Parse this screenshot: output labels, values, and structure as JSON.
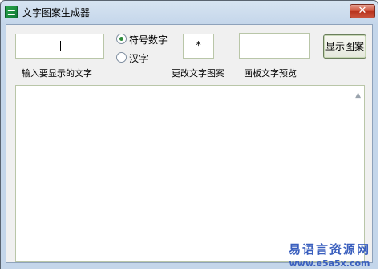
{
  "window": {
    "title": "文字图案生成器"
  },
  "inputs": {
    "text_input_value": "|",
    "symbol_value": "*",
    "preview_value": ""
  },
  "radios": [
    {
      "label": "符号数字",
      "checked": true
    },
    {
      "label": "汉字",
      "checked": false
    }
  ],
  "labels": {
    "input_text": "输入要显示的文字",
    "change_pattern": "更改文字图案",
    "canvas_preview": "画板文字预览"
  },
  "buttons": {
    "show_pattern": "显示图案"
  },
  "output": {
    "content": ""
  },
  "watermark": {
    "line1": "易语言资源网",
    "line2": "www.e5a5x.com"
  },
  "colors": {
    "accent": "#2e8b3a",
    "watermark": "#3a5fbe",
    "close": "#c9523c"
  }
}
